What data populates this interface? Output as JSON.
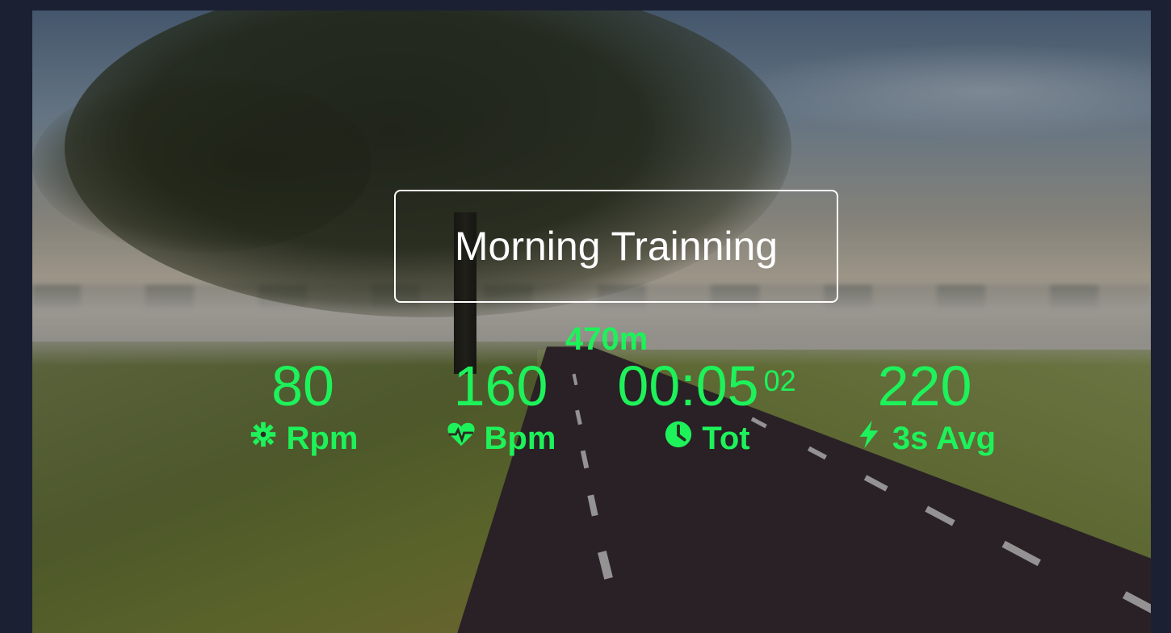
{
  "workout": {
    "title": "Morning Trainning",
    "distance": "470m"
  },
  "metrics": {
    "rpm": {
      "value": "80",
      "label": "Rpm",
      "icon": "gear-icon"
    },
    "bpm": {
      "value": "160",
      "label": "Bpm",
      "icon": "heart-pulse-icon"
    },
    "time": {
      "value": "00:05",
      "seconds": "02",
      "label": "Tot",
      "icon": "clock-icon"
    },
    "power": {
      "value": "220",
      "label": "3s Avg",
      "icon": "lightning-icon"
    }
  },
  "colors": {
    "metric_green": "#1ef25a",
    "title_white": "#ffffff",
    "page_background": "#1c2033"
  }
}
